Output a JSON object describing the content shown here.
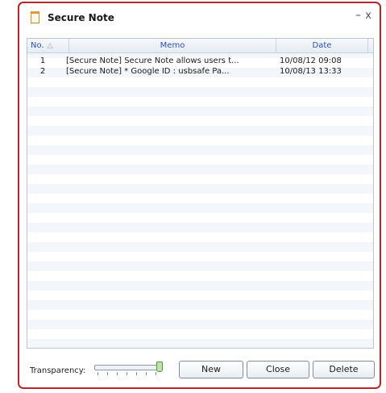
{
  "window": {
    "title": "Secure Note",
    "minimize_glyph": "–",
    "close_glyph": "x",
    "icon": "note-icon"
  },
  "list": {
    "columns": {
      "no": "No.",
      "memo": "Memo",
      "date": "Date"
    },
    "sort_icon": "△",
    "rows": [
      {
        "no": "1",
        "memo": "[Secure Note]   Secure Note allows users t...",
        "date": "10/08/12  09:08"
      },
      {
        "no": "2",
        "memo": "[Secure Note]   * Google    ID : usbsafe  Pa...",
        "date": "10/08/13  13:33"
      }
    ]
  },
  "footer": {
    "transparency_label": "Transparency:",
    "transparency_value": 1.0,
    "buttons": {
      "new": "New",
      "close": "Close",
      "delete": "Delete"
    }
  },
  "colors": {
    "window_border": "#b8262a",
    "header_text": "#2a4fb5"
  }
}
